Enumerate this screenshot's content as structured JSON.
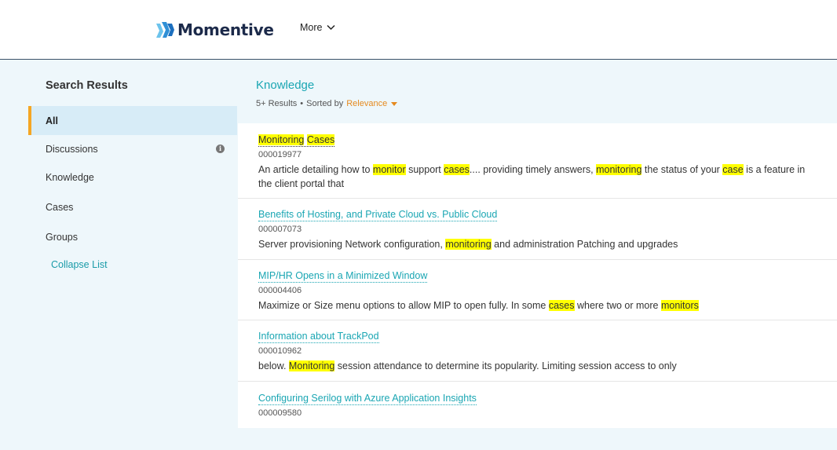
{
  "header": {
    "logo_text": "Momentive",
    "more_label": "More"
  },
  "sidebar": {
    "title": "Search Results",
    "items": [
      {
        "label": "All",
        "active": true
      },
      {
        "label": "Discussions"
      },
      {
        "label": "Knowledge"
      },
      {
        "label": "Cases"
      },
      {
        "label": "Groups"
      }
    ],
    "collapse_label": "Collapse List"
  },
  "main": {
    "section_title": "Knowledge",
    "results_count": "5+ Results",
    "separator": "•",
    "sorted_by_label": "Sorted by",
    "sort_value": "Relevance",
    "highlight_color": "#ffff00",
    "accent_color": "#1aa6b3",
    "sort_color": "#e58a1f",
    "results": [
      {
        "title": [
          "Monitoring",
          " ",
          "Cases"
        ],
        "number": "000019977",
        "snippet": [
          "An article detailing how to ",
          "monitor",
          " support ",
          "cases",
          ".... providing timely answers, ",
          "monitoring",
          " the status of your ",
          "case",
          " is a feature in the client portal that"
        ]
      },
      {
        "title": "Benefits of Hosting, and Private Cloud vs. Public Cloud",
        "number": "000007073",
        "snippet": [
          "Server provisioning Network configuration, ",
          "monitoring",
          " and administration Patching and upgrades"
        ]
      },
      {
        "title": "MIP/HR Opens in a Minimized Window",
        "number": "000004406",
        "snippet": [
          "Maximize or Size menu options to allow MIP to open fully. In some ",
          "cases",
          " where two or more ",
          "monitors"
        ]
      },
      {
        "title": "Information about TrackPod",
        "number": "000010962",
        "snippet": [
          "below. ",
          "Monitoring",
          " session attendance to determine its popularity. Limiting session access to only"
        ]
      },
      {
        "title": "Configuring Serilog with Azure Application Insights",
        "number": "000009580"
      }
    ]
  }
}
